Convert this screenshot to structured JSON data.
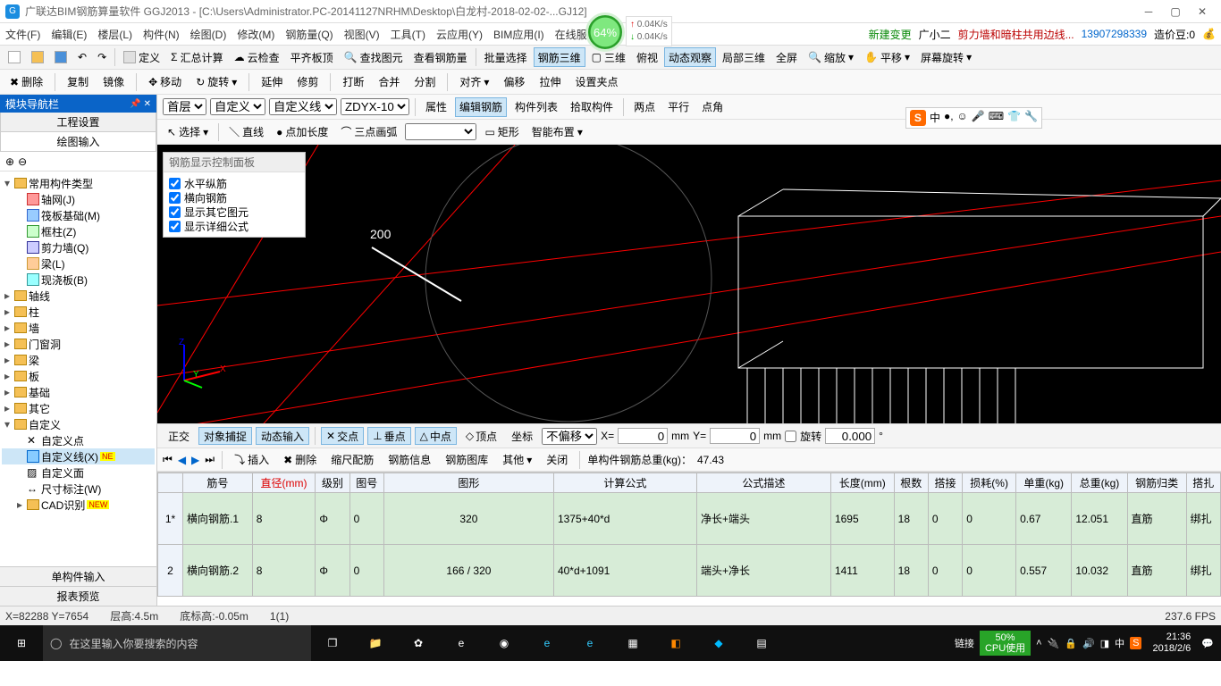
{
  "title": "广联达BIM钢筋算量软件 GGJ2013 - [C:\\Users\\Administrator.PC-20141127NRHM\\Desktop\\白龙村-2018-02-02-...GJ12]",
  "menubar": [
    "文件(F)",
    "编辑(E)",
    "楼层(L)",
    "构件(N)",
    "绘图(D)",
    "修改(M)",
    "钢筋量(Q)",
    "视图(V)",
    "工具(T)",
    "云应用(Y)",
    "BIM应用(I)",
    "在线服务",
    "(B)"
  ],
  "menu_right": {
    "newchange": "新建变更",
    "guang": "广小二",
    "warn": "剪力墙和暗柱共用边线...",
    "user": "13907298339",
    "credit": "造价豆:0"
  },
  "toolbar1": [
    "定义",
    "汇总计算",
    "云检查",
    "平齐板顶",
    "查找图元",
    "查看钢筋量",
    "批量选择",
    "钢筋三维",
    "三维",
    "俯视",
    "动态观察",
    "局部三维",
    "全屏",
    "缩放",
    "平移",
    "屏幕旋转"
  ],
  "toolbar2": [
    "删除",
    "复制",
    "镜像",
    "移动",
    "旋转",
    "延伸",
    "修剪",
    "打断",
    "合并",
    "分割",
    "对齐",
    "偏移",
    "拉伸",
    "设置夹点"
  ],
  "toolbar3": {
    "floor": "首层",
    "cat": "自定义",
    "sub": "自定义线",
    "code": "ZDYX-10",
    "btns": [
      "属性",
      "编辑钢筋",
      "构件列表",
      "拾取构件",
      "两点",
      "平行",
      "点角"
    ]
  },
  "toolbar4": {
    "select": "选择",
    "line": "直线",
    "ptlen": "点加长度",
    "arc": "三点画弧",
    "rect": "矩形",
    "smart": "智能布置"
  },
  "left": {
    "header": "模块导航栏",
    "tab_settings": "工程设置",
    "tab_draw": "绘图输入",
    "tree_root": "常用构件类型",
    "tree_items": [
      "轴网(J)",
      "筏板基础(M)",
      "框柱(Z)",
      "剪力墙(Q)",
      "梁(L)",
      "现浇板(B)"
    ],
    "folders": [
      "轴线",
      "柱",
      "墙",
      "门窗洞",
      "梁",
      "板",
      "基础",
      "其它",
      "自定义"
    ],
    "custom_sub": [
      "自定义点",
      "自定义线(X)",
      "自定义面",
      "尺寸标注(W)",
      "CAD识别"
    ],
    "bottom_tab1": "单构件输入",
    "bottom_tab2": "报表预览"
  },
  "rebar_panel": {
    "title": "钢筋显示控制面板",
    "opts": [
      "水平纵筋",
      "横向钢筋",
      "显示其它图元",
      "显示详细公式"
    ]
  },
  "snap": {
    "ortho": "正交",
    "osnap": "对象捕捉",
    "dyn": "动态输入",
    "cross": "交点",
    "perp": "垂点",
    "mid": "中点",
    "end": "顶点",
    "coord": "坐标",
    "offset": "不偏移",
    "x": "0",
    "y": "0",
    "rot": "旋转",
    "angle": "0.000"
  },
  "tabletb": {
    "insert": "插入",
    "delete": "删除",
    "scale": "缩尺配筋",
    "info": "钢筋信息",
    "lib": "钢筋图库",
    "other": "其他",
    "close": "关闭",
    "total_lbl": "单构件钢筋总重(kg)：",
    "total_val": "47.43"
  },
  "grid": {
    "headers": [
      "",
      "筋号",
      "直径(mm)",
      "级别",
      "图号",
      "图形",
      "计算公式",
      "公式描述",
      "长度(mm)",
      "根数",
      "搭接",
      "损耗(%)",
      "单重(kg)",
      "总重(kg)",
      "钢筋归类",
      "搭扎"
    ],
    "rows": [
      {
        "n": "1*",
        "name": "横向钢筋.1",
        "dia": "8",
        "lvl": "Φ",
        "pic": "0",
        "shape": "320",
        "formula": "1375+40*d",
        "desc": "净长+端头",
        "len": "1695",
        "cnt": "18",
        "lap": "0",
        "loss": "0",
        "uw": "0.67",
        "tw": "12.051",
        "cls": "直筋",
        "tie": "绑扎"
      },
      {
        "n": "2",
        "name": "横向钢筋.2",
        "dia": "8",
        "lvl": "Φ",
        "pic": "0",
        "shape": "166 / 320",
        "formula": "40*d+1091",
        "desc": "端头+净长",
        "len": "1411",
        "cnt": "18",
        "lap": "0",
        "loss": "0",
        "uw": "0.557",
        "tw": "10.032",
        "cls": "直筋",
        "tie": "绑扎"
      }
    ]
  },
  "status": {
    "xy": "X=82288 Y=7654",
    "floor": "层高:4.5m",
    "base": "底标高:-0.05m",
    "sel": "1(1)",
    "fps": "237.6 FPS"
  },
  "float": {
    "pct": "64%",
    "up": "0.04K/s",
    "dn": "0.04K/s"
  },
  "taskbar": {
    "search": "在这里输入你要搜索的内容",
    "link": "链接",
    "cpu1": "50%",
    "cpu2": "CPU使用",
    "time": "21:36",
    "date": "2018/2/6",
    "ime": "中"
  },
  "ime_panel": {
    "cn": "中"
  },
  "viewport": {
    "dim": "200"
  }
}
